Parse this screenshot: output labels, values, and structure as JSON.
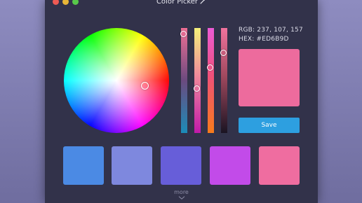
{
  "window": {
    "title": "Color Picker",
    "title_icon": "eyedropper-icon"
  },
  "color_info": {
    "rgb_label": "RGB:",
    "rgb_value": "237, 107, 157",
    "hex_label": "HEX:",
    "hex_value": "#ED6B9D"
  },
  "preview_color": "#ED6B9D",
  "save_label": "Save",
  "sliders": [
    {
      "level": 0.06
    },
    {
      "level": 0.58
    },
    {
      "level": 0.38
    },
    {
      "level": 0.24
    }
  ],
  "swatches": [
    "#4b8ae4",
    "#7e88de",
    "#675ed9",
    "#c24be9",
    "#ef6da0"
  ],
  "more_label": "more",
  "colors": {
    "window_bg": "#32324a",
    "accent": "#2d9fe0"
  }
}
